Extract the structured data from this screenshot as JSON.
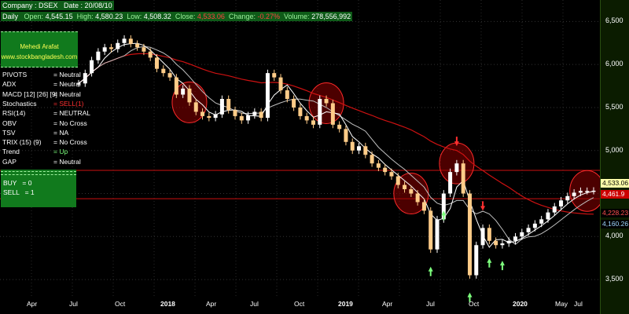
{
  "header": {
    "company_label": "Company : DSEX",
    "date_label": "Date : 20/08/10",
    "period": "Daily",
    "open_label": "Open:",
    "open": "4,545.15",
    "high_label": "High:",
    "high": "4,580.23",
    "low_label": "Low:",
    "low": "4,508.32",
    "close_label": "Close:",
    "close": "4,533.06",
    "change_label": "Change:",
    "change": "-0.27%",
    "volume_label": "Volume:",
    "volume": "278,556,992"
  },
  "author": {
    "name": "Mehedi Arafat",
    "site": "www.stockbangladesh.com"
  },
  "indicators": [
    {
      "name": "PIVOTS",
      "value": "= Neutral",
      "status": "neutral"
    },
    {
      "name": "ADX",
      "value": "= Neutral",
      "status": "neutral"
    },
    {
      "name": "MACD [12] [26] [9]",
      "value": "= Neutral",
      "status": "neutral"
    },
    {
      "name": "Stochastics",
      "value": "= SELL(1)",
      "status": "sell"
    },
    {
      "name": "RSI(14)",
      "value": "= NEUTRAL",
      "status": "neutral"
    },
    {
      "name": "OBV",
      "value": "= No Cross",
      "status": "neutral"
    },
    {
      "name": "TSV",
      "value": "= NA",
      "status": "neutral"
    },
    {
      "name": "TRIX (15) (9)",
      "value": "= No Cross",
      "status": "neutral"
    },
    {
      "name": "Trend",
      "value": "= Up",
      "status": "up"
    },
    {
      "name": "GAP",
      "value": "= Neutral",
      "status": "neutral"
    }
  ],
  "signals": {
    "buy_label": "BUY",
    "buy_value": "= 0",
    "sell_label": "SELL",
    "sell_value": "= 1"
  },
  "price_axis": {
    "ticks": [
      "6,500",
      "6,000",
      "5,500",
      "5,000",
      "4,500",
      "4,000",
      "3,500"
    ]
  },
  "price_tags": [
    {
      "value": "4,533.06",
      "bg": "#ffffaa",
      "fg": "#000000"
    },
    {
      "value": "4,461.9",
      "bg": "#cc0000",
      "fg": "#ffffff"
    },
    {
      "value": "4,228.23",
      "bg": "#000000",
      "fg": "#ff5050"
    },
    {
      "value": "4,160.26",
      "bg": "#000000",
      "fg": "#9fd7ff"
    }
  ],
  "time_axis": {
    "labels": [
      {
        "text": "Apr",
        "year": false
      },
      {
        "text": "Jul",
        "year": false
      },
      {
        "text": "Oct",
        "year": false
      },
      {
        "text": "2018",
        "year": true
      },
      {
        "text": "Apr",
        "year": false
      },
      {
        "text": "Jul",
        "year": false
      },
      {
        "text": "Oct",
        "year": false
      },
      {
        "text": "2019",
        "year": true
      },
      {
        "text": "Apr",
        "year": false
      },
      {
        "text": "Jul",
        "year": false
      },
      {
        "text": "Oct",
        "year": false
      },
      {
        "text": "2020",
        "year": true
      },
      {
        "text": "May",
        "year": false
      },
      {
        "text": "Jul",
        "year": false
      }
    ]
  },
  "colors": {
    "background": "#000000",
    "candle_up": "#ffffff",
    "candle_down": "#ffcc88",
    "ma_fast": "#ffffff",
    "ma_mid": "#c0c0c0",
    "ma_slow": "#cc1111",
    "horizontal_line": "#cc1111",
    "circle_fill": "#8b0000",
    "arrow_up": "#7dff7d",
    "arrow_down": "#ff3030"
  },
  "chart_data": {
    "type": "line",
    "ylim": [
      3300,
      6750
    ],
    "horizontal_levels": [
      4770,
      4440
    ],
    "series": [
      {
        "name": "",
        "x": [
          0,
          1,
          2,
          3,
          4,
          5,
          6,
          7,
          8,
          9,
          10,
          11,
          12,
          13,
          14,
          15,
          16,
          17,
          18,
          19,
          20,
          21,
          22,
          23,
          24,
          25,
          26,
          27,
          28,
          29,
          30,
          31,
          32,
          33,
          34,
          35,
          36,
          37,
          38,
          39,
          40,
          41,
          42,
          43,
          44,
          45,
          46,
          47,
          48,
          49,
          50,
          51,
          52,
          53,
          54,
          55,
          56,
          57,
          58,
          59,
          60,
          61,
          62,
          63,
          64,
          65,
          66,
          67,
          68,
          69,
          70,
          71,
          72,
          73,
          74,
          75,
          76,
          77,
          78,
          79
        ],
        "y": [
          5780,
          5900,
          6050,
          6150,
          6200,
          6180,
          6250,
          6300,
          6240,
          6200,
          6150,
          6080,
          5950,
          5900,
          5850,
          5650,
          5720,
          5560,
          5450,
          5400,
          5380,
          5420,
          5600,
          5470,
          5400,
          5350,
          5410,
          5450,
          5380,
          5900,
          5850,
          5700,
          5600,
          5500,
          5400,
          5350,
          5300,
          5600,
          5550,
          5300,
          5250,
          5100,
          5000,
          5050,
          4950,
          4850,
          4800,
          4750,
          4700,
          4600,
          4550,
          4500,
          4400,
          4300,
          3850,
          4200,
          4500,
          4750,
          4850,
          4500,
          3550,
          3900,
          4100,
          3950,
          3900,
          3920,
          3950,
          4000,
          4050,
          4100,
          4150,
          4200,
          4280,
          4350,
          4420,
          4470,
          4510,
          4530,
          4530,
          4533
        ]
      }
    ]
  }
}
